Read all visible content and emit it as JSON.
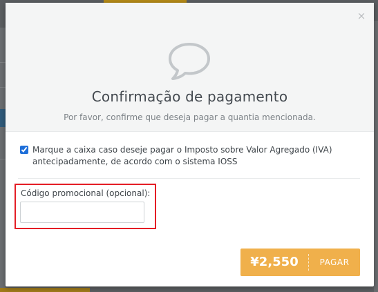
{
  "modal": {
    "close_glyph": "×",
    "title": "Confirmação de pagamento",
    "subtitle": "Por favor, confirme que deseja pagar a quantia mencionada.",
    "icon": "speech-bubble-icon"
  },
  "iva": {
    "checked": true,
    "text": "Marque a caixa caso deseje pagar o Imposto sobre Valor Agregado (IVA) antecipadamente, de acordo com o sistema IOSS"
  },
  "promo": {
    "label": "Código promocional (opcional):",
    "value": "",
    "placeholder": ""
  },
  "pay_button": {
    "amount": "¥2,550",
    "label": "PAGAR"
  },
  "colors": {
    "accent": "#f0b04b",
    "highlight": "#e41d25",
    "header_bg": "#f4f5f5"
  }
}
